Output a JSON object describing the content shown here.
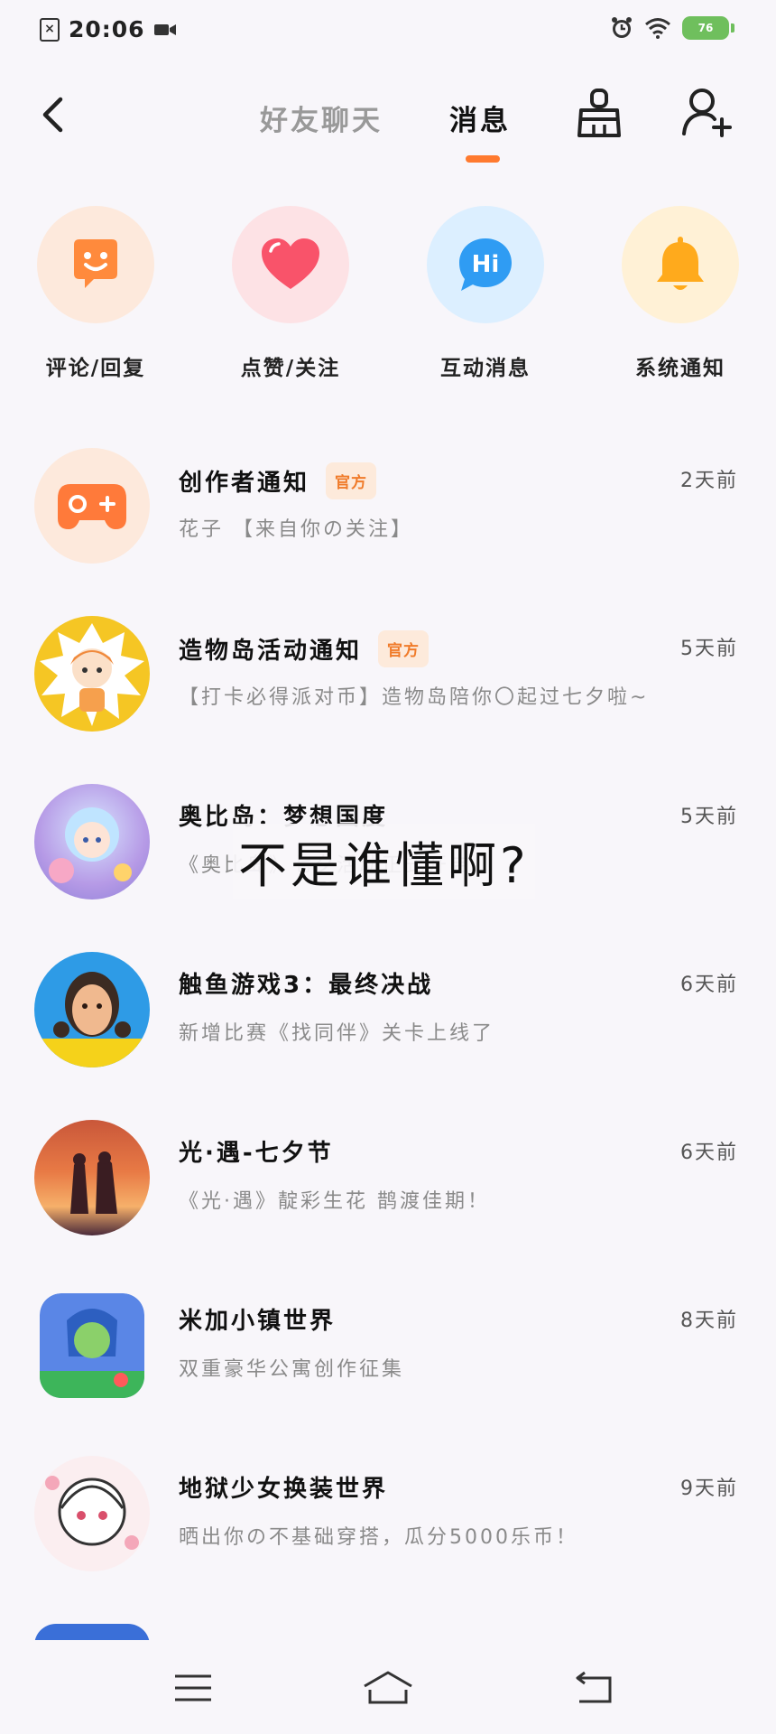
{
  "status_bar": {
    "time": "20:06",
    "battery": "76"
  },
  "header": {
    "tabs": [
      {
        "label": "好友聊天"
      },
      {
        "label": "消息"
      }
    ],
    "active_tab": "消息"
  },
  "categories": [
    {
      "label": "评论/回复",
      "icon": "smile-chat-icon",
      "bg": "#fde9dc",
      "color": "#ff8a3c"
    },
    {
      "label": "点赞/关注",
      "icon": "heart-icon",
      "bg": "#fde2e5",
      "color": "#f9536a"
    },
    {
      "label": "互动消息",
      "icon": "hi-bubble-icon",
      "bg": "#dcefff",
      "color": "#2f9cf3"
    },
    {
      "label": "系统通知",
      "icon": "bell-icon",
      "bg": "#fff1d6",
      "color": "#ffaa1c"
    }
  ],
  "messages": [
    {
      "title": "创作者通知",
      "badge": "官方",
      "time": "2天前",
      "preview": "花子 【来自你の关注】"
    },
    {
      "title": "造物岛活动通知",
      "badge": "官方",
      "time": "5天前",
      "preview": "【打卡必得派对币】造物岛陪你〇起过七夕啦~"
    },
    {
      "title": "奥比岛：梦想国度",
      "badge": "",
      "time": "5天前",
      "preview": "《奥比岛》七夕活动正式开启！"
    },
    {
      "title": "触鱼游戏3：最终决战",
      "badge": "",
      "time": "6天前",
      "preview": "新增比赛《找同伴》关卡上线了"
    },
    {
      "title": "光·遇-七夕节",
      "badge": "",
      "time": "6天前",
      "preview": "《光·遇》靛彩生花 鹊渡佳期！"
    },
    {
      "title": "米加小镇世界",
      "badge": "",
      "time": "8天前",
      "preview": "双重豪华公寓创作征集"
    },
    {
      "title": "地狱少女换装世界",
      "badge": "",
      "time": "9天前",
      "preview": "晒出你の不基础穿搭，瓜分5000乐币！"
    }
  ],
  "overlay_caption": "不是谁懂啊?",
  "colors": {
    "accent": "#ff7a2f",
    "badge_bg": "#fdeadb",
    "badge_text": "#f07b2a"
  }
}
